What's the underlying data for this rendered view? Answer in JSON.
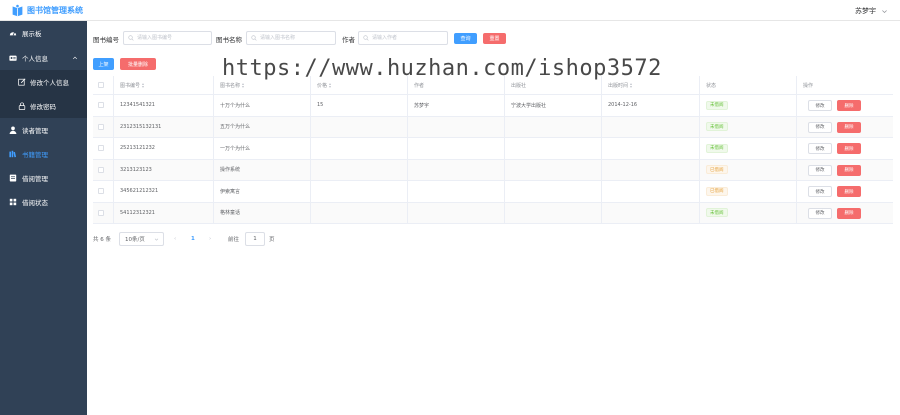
{
  "app": {
    "title": "图书馆管理系统"
  },
  "user": {
    "name": "苏梦宇"
  },
  "sidebar": {
    "items": [
      {
        "label": "展示板",
        "icon": "dashboard-icon"
      },
      {
        "label": "个人信息",
        "icon": "id-card-icon"
      },
      {
        "label": "修改个人信息",
        "icon": "edit-icon"
      },
      {
        "label": "修改密码",
        "icon": "lock-icon"
      },
      {
        "label": "读者管理",
        "icon": "user-icon"
      },
      {
        "label": "书籍管理",
        "icon": "books-icon"
      },
      {
        "label": "借阅管理",
        "icon": "ledger-icon"
      },
      {
        "label": "借阅状态",
        "icon": "grid-icon"
      }
    ]
  },
  "search": {
    "isbn_label": "图书编号",
    "isbn_placeholder": "请输入图书编号",
    "name_label": "图书名称",
    "name_placeholder": "请输入图书名称",
    "author_label": "作者",
    "author_placeholder": "请输入作者",
    "query_label": "查询",
    "reset_label": "重置"
  },
  "toolbar": {
    "add_label": "上架",
    "batch_delete_label": "批量删除"
  },
  "watermark": "https://www.huzhan.com/ishop3572",
  "table": {
    "columns": [
      "图书编号",
      "图书名称",
      "价格",
      "作者",
      "出版社",
      "出版时间",
      "状态",
      "操作"
    ],
    "edit_label": "修改",
    "delete_label": "删除",
    "rows": [
      {
        "isbn": "12341541321",
        "name": "十万个为什么",
        "price": "15",
        "author": "苏梦宇",
        "publisher": "宁波大学出版社",
        "date": "2014-12-16",
        "status": "未借阅",
        "status_type": "ok"
      },
      {
        "isbn": "2312315132131",
        "name": "五万个为什么",
        "price": "",
        "author": "",
        "publisher": "",
        "date": "",
        "status": "未借阅",
        "status_type": "ok"
      },
      {
        "isbn": "25213121232",
        "name": "一万个为什么",
        "price": "",
        "author": "",
        "publisher": "",
        "date": "",
        "status": "未借阅",
        "status_type": "ok"
      },
      {
        "isbn": "3213123123",
        "name": "操作系统",
        "price": "",
        "author": "",
        "publisher": "",
        "date": "",
        "status": "已借阅",
        "status_type": "out"
      },
      {
        "isbn": "345621212321",
        "name": "伊索寓言",
        "price": "",
        "author": "",
        "publisher": "",
        "date": "",
        "status": "已借阅",
        "status_type": "out"
      },
      {
        "isbn": "54112312321",
        "name": "格林童话",
        "price": "",
        "author": "",
        "publisher": "",
        "date": "",
        "status": "未借阅",
        "status_type": "ok"
      }
    ]
  },
  "pagination": {
    "total": "共 6 条",
    "page_size": "10条/页",
    "prev": "‹",
    "current": "1",
    "next": "›",
    "goto_label": "前往",
    "goto_value": "1",
    "page_suffix": "页"
  },
  "colors": {
    "primary": "#409eff",
    "danger": "#f56c6c",
    "success": "#67c23a",
    "warning": "#e6a23c",
    "sidebar": "#304156"
  }
}
